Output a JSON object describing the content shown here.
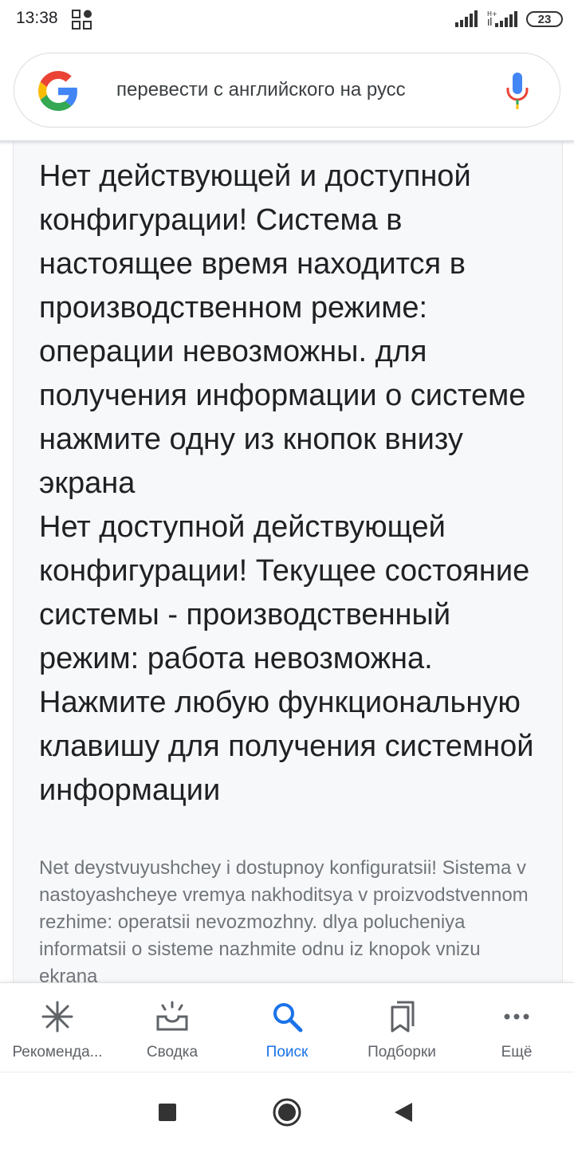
{
  "status_bar": {
    "time": "13:38",
    "battery": "23",
    "icons": [
      "app-grid-icon",
      "signal-icon",
      "signal-hplus-icon",
      "battery-icon"
    ]
  },
  "search": {
    "query": "перевести с английского на русс",
    "icons": [
      "google-logo",
      "microphone-icon"
    ]
  },
  "result": {
    "translation_paragraphs": [
      "Нет действующей и доступной конфигурации! Система в настоящее время находится в производственном режиме: операции невозможны. для получения информации о системе нажмите одну из кнопок внизу экрана",
      "Нет доступной действующей конфигурации! Текущее состояние системы - производственный режим: работа невозможна. Нажмите любую функциональную клавишу для получения системной информации"
    ],
    "transliteration": "Net deystvuyushchey i dostupnoy konfiguratsii! Sistema v nastoyashcheye vremya nakhoditsya v proizvodstvennom rezhime: operatsii nevozmozhny. dlya polucheniya informatsii o sisteme nazhmite odnu iz knopok vnizu ekrana"
  },
  "bottom_nav": {
    "items": [
      {
        "label": "Рекоменда...",
        "icon": "sparkle-icon",
        "active": false
      },
      {
        "label": "Сводка",
        "icon": "inbox-sunrise-icon",
        "active": false
      },
      {
        "label": "Поиск",
        "icon": "search-icon",
        "active": true
      },
      {
        "label": "Подборки",
        "icon": "bookmarks-icon",
        "active": false
      },
      {
        "label": "Ещё",
        "icon": "more-dots-icon",
        "active": false
      }
    ]
  },
  "system_nav": {
    "buttons": [
      "recents-button",
      "home-button",
      "back-button"
    ]
  },
  "colors": {
    "accent": "#1a73e8",
    "text": "#202124",
    "muted": "#70757a"
  }
}
